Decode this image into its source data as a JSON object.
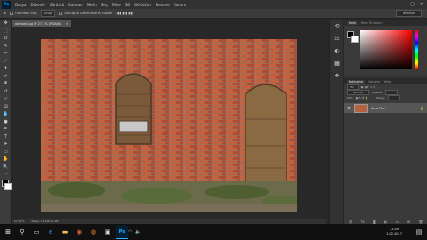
{
  "menubar": {
    "app_badge": "Ps",
    "items": [
      "Dosya",
      "Düzenle",
      "Görüntü",
      "Katman",
      "Metin",
      "Seç",
      "Filtre",
      "3B",
      "Görünüm",
      "Pencere",
      "Yardım"
    ],
    "window_controls": [
      "–",
      "▢",
      "✕"
    ]
  },
  "options_bar": {
    "auto_select_label": "Otomatik Seç:",
    "auto_select_value": "Grup",
    "transform_label": "Dönüşüm Denetimlerini Göster",
    "workspace": "Temeller"
  },
  "tools": [
    "move-icon",
    "marquee-icon",
    "lasso-icon",
    "quick-select-icon",
    "crop-icon",
    "eyedropper-icon",
    "healing-icon",
    "brush-icon",
    "clone-stamp-icon",
    "history-brush-icon",
    "eraser-icon",
    "gradient-icon",
    "blur-icon",
    "dodge-icon",
    "pen-icon",
    "type-icon",
    "path-select-icon",
    "shape-icon",
    "hand-icon",
    "zoom-icon",
    "more-tools-icon"
  ],
  "document": {
    "tab_title": "old wall.jpg @ 27,1% (RGB/8)",
    "zoom": "27,17%",
    "doc_info": "Belge: 11,4M/11,4M"
  },
  "side_icons": [
    "history-icon",
    "properties-icon",
    "adjustments-icon",
    "libraries-icon",
    "swatches-icon"
  ],
  "color_panel": {
    "tabs": [
      "Renk",
      "Renk Örnekleri"
    ],
    "fg_color": "#000000",
    "bg_color": "#ffffff"
  },
  "layers_panel": {
    "tabs": [
      "Katmanlar",
      "Kanallar",
      "Yollar"
    ],
    "filter_label": "Tür",
    "blend_mode": "Normal",
    "opacity_label": "Opaklık:",
    "lock_label": "Kilit:",
    "fill_label": "Dolgu:",
    "layer_name": "Arka Plan",
    "footer_icons": [
      "link-icon",
      "fx-icon",
      "mask-icon",
      "adjustment-icon",
      "group-icon",
      "new-layer-icon",
      "trash-icon"
    ]
  },
  "taskbar": {
    "time": "12:09",
    "date": "1.02.2017",
    "ps_label": "Ps"
  }
}
